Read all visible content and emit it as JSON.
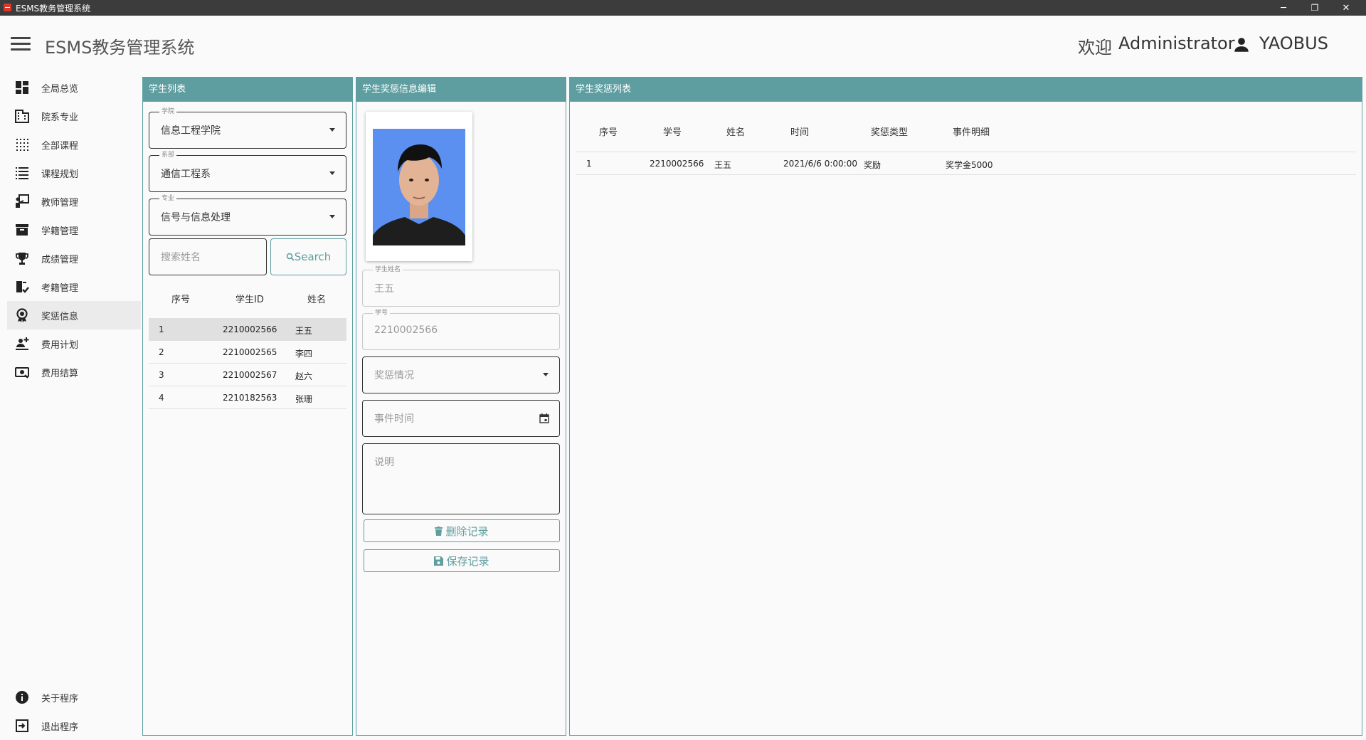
{
  "window": {
    "title": "ESMS教务管理系统",
    "minimize": "─",
    "restore": "❐",
    "close": "✕"
  },
  "header": {
    "app_title": "ESMS教务管理系统",
    "welcome": "欢迎",
    "role": "Administrator",
    "username": "YAOBUS"
  },
  "sidebar": {
    "items": [
      {
        "label": "全局总览",
        "icon": "dashboard-icon"
      },
      {
        "label": "院系专业",
        "icon": "building-icon"
      },
      {
        "label": "全部课程",
        "icon": "grid-dots-icon"
      },
      {
        "label": "课程规划",
        "icon": "list-icon"
      },
      {
        "label": "教师管理",
        "icon": "teacher-icon"
      },
      {
        "label": "学籍管理",
        "icon": "archive-icon"
      },
      {
        "label": "成绩管理",
        "icon": "trophy-icon"
      },
      {
        "label": "考籍管理",
        "icon": "exam-icon"
      },
      {
        "label": "奖惩信息",
        "icon": "award-icon"
      },
      {
        "label": "费用计划",
        "icon": "plan-icon"
      },
      {
        "label": "费用结算",
        "icon": "cash-icon"
      }
    ],
    "bottom": [
      {
        "label": "关于程序",
        "icon": "info-icon"
      },
      {
        "label": "退出程序",
        "icon": "exit-icon"
      }
    ],
    "active_index": 8
  },
  "student_list": {
    "header": "学生列表",
    "college": {
      "label": "学院",
      "value": "信息工程学院"
    },
    "department": {
      "label": "系部",
      "value": "通信工程系"
    },
    "major": {
      "label": "专业",
      "value": "信号与信息处理"
    },
    "search_placeholder": "搜索姓名",
    "search_button": "Search",
    "columns": [
      "序号",
      "学生ID",
      "姓名"
    ],
    "rows": [
      [
        "1",
        "2210002566",
        "王五"
      ],
      [
        "2",
        "2210002565",
        "李四"
      ],
      [
        "3",
        "2210002567",
        "赵六"
      ],
      [
        "4",
        "2210182563",
        "张珊"
      ]
    ],
    "selected_index": 0
  },
  "editor": {
    "header": "学生奖惩信息编辑",
    "name": {
      "label": "学生姓名",
      "value": "王五"
    },
    "student_no": {
      "label": "学号",
      "value": "2210002566"
    },
    "reward_type": {
      "placeholder": "奖惩情况"
    },
    "event_time": {
      "placeholder": "事件时间"
    },
    "description": {
      "placeholder": "说明"
    },
    "delete_button": "删除记录",
    "save_button": "保存记录"
  },
  "reward_list": {
    "header": "学生奖惩列表",
    "columns": [
      "序号",
      "学号",
      "姓名",
      "时间",
      "奖惩类型",
      "事件明细"
    ],
    "rows": [
      [
        "1",
        "2210002566",
        "王五",
        "2021/6/6 0:00:00",
        "奖励",
        "奖学金5000"
      ]
    ]
  }
}
